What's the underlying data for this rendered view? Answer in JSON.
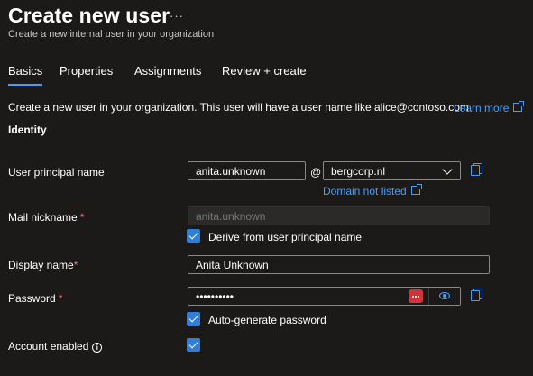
{
  "header": {
    "title": "Create new user",
    "more_label": "···",
    "subtitle": "Create a new internal user in your organization"
  },
  "tabs": [
    {
      "label": "Basics",
      "active": true
    },
    {
      "label": "Properties",
      "active": false
    },
    {
      "label": "Assignments",
      "active": false
    },
    {
      "label": "Review + create",
      "active": false
    }
  ],
  "intro": {
    "text": "Create a new user in your organization. This user will have a user name like alice@contoso.com.",
    "learn_more": "Learn more"
  },
  "section": {
    "title": "Identity"
  },
  "fields": {
    "upn": {
      "label": "User principal name",
      "value": "anita.unknown",
      "at": "@",
      "domain": "bergcorp.nl",
      "domain_link": "Domain not listed"
    },
    "mail_nickname": {
      "label": "Mail nickname",
      "required": "*",
      "value": "anita.unknown",
      "derive_label": "Derive from user principal name",
      "derive_checked": true
    },
    "display_name": {
      "label": "Display name",
      "required": "*",
      "value": "Anita Unknown"
    },
    "password": {
      "label": "Password",
      "required": "*",
      "masked_value": "••••••••••",
      "auto_label": "Auto-generate password",
      "auto_checked": true
    },
    "account_enabled": {
      "label": "Account enabled",
      "info_glyph": "i",
      "checked": true
    }
  },
  "icons": {
    "more": "more-horizontal-icon",
    "external_link": "external-link-icon",
    "copy": "copy-icon",
    "chevron": "chevron-down-icon",
    "password_manager": "password-manager-icon",
    "reveal": "eye-icon",
    "info": "info-icon"
  },
  "colors": {
    "background": "#1b1a19",
    "accent": "#479ef5",
    "checkbox": "#2f7ed8",
    "required": "#f1707b",
    "password_badge": "#d13438"
  }
}
